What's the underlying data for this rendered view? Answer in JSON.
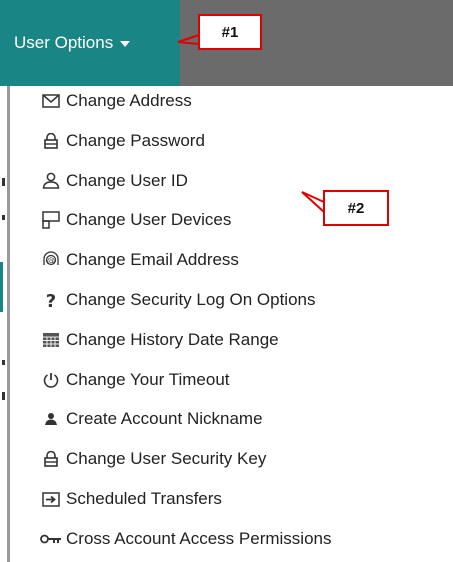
{
  "header": {
    "button_label": "User Options"
  },
  "annotations": {
    "first": "#1",
    "second": "#2"
  },
  "colors": {
    "topbar": "#6b6b6b",
    "button_bg": "#1a8585",
    "annotation_border": "#e00000"
  },
  "menu": {
    "items": [
      {
        "label": "Change Address",
        "icon": "envelope-icon"
      },
      {
        "label": "Change Password",
        "icon": "lock-icon"
      },
      {
        "label": "Change User ID",
        "icon": "user-icon"
      },
      {
        "label": "Change User Devices",
        "icon": "devices-icon"
      },
      {
        "label": "Change Email Address",
        "icon": "at-sign-icon"
      },
      {
        "label": "Change Security Log On Options",
        "icon": "question-icon"
      },
      {
        "label": "Change History Date Range",
        "icon": "calendar-icon"
      },
      {
        "label": "Change Your Timeout",
        "icon": "power-icon"
      },
      {
        "label": "Create Account Nickname",
        "icon": "person-icon"
      },
      {
        "label": "Change User Security Key",
        "icon": "lock-icon"
      },
      {
        "label": "Scheduled Transfers",
        "icon": "transfer-icon"
      },
      {
        "label": "Cross Account Access Permissions",
        "icon": "key-icon"
      }
    ]
  }
}
